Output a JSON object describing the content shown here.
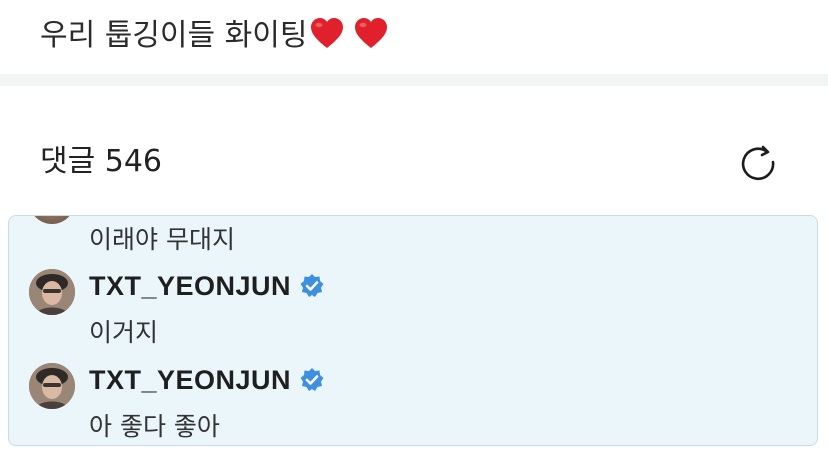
{
  "post": {
    "text": "우리 툽깅이들 화이팅",
    "emojis": [
      "heart-icon",
      "heart-icon"
    ],
    "heart_color": "#e0202b"
  },
  "comments": {
    "header": "댓글 546",
    "refresh_icon": "refresh-icon",
    "thread": {
      "background": "#ebf6fb",
      "partial_reply": {
        "text": "이래야 무대지"
      },
      "replies": [
        {
          "author": "TXT_YEONJUN",
          "verified": true,
          "text": "이거지"
        },
        {
          "author": "TXT_YEONJUN",
          "verified": true,
          "text": "아 좋다 좋아"
        }
      ]
    },
    "verified_color": "#3d8fe0"
  }
}
